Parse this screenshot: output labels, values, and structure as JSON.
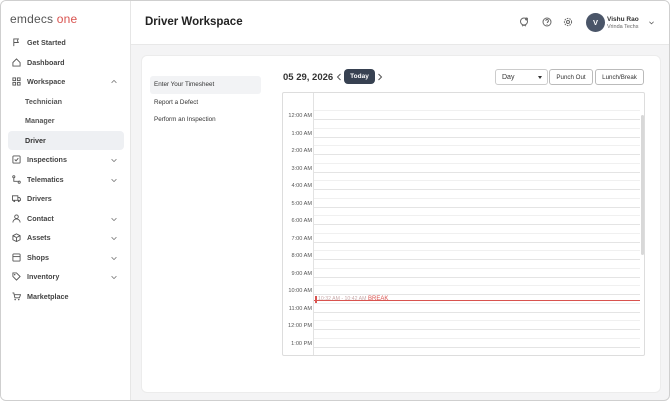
{
  "brand": {
    "logo_text": "emdecs ",
    "logo_accent": "one",
    "accent_color": "#d9534f"
  },
  "sidebar": {
    "items": [
      {
        "label": "Get Started",
        "icon": "flag-icon"
      },
      {
        "label": "Dashboard",
        "icon": "home-icon"
      },
      {
        "label": "Workspace",
        "icon": "grid-icon",
        "expanded": true,
        "children": [
          "Technician",
          "Manager",
          "Driver"
        ],
        "active_child": "Driver"
      },
      {
        "label": "Inspections",
        "icon": "checkbox-icon",
        "has_chevron": true
      },
      {
        "label": "Telematics",
        "icon": "route-icon",
        "has_chevron": true
      },
      {
        "label": "Drivers",
        "icon": "truck-icon"
      },
      {
        "label": "Contact",
        "icon": "person-icon",
        "has_chevron": true
      },
      {
        "label": "Assets",
        "icon": "box-icon",
        "has_chevron": true
      },
      {
        "label": "Shops",
        "icon": "shop-icon",
        "has_chevron": true
      },
      {
        "label": "Inventory",
        "icon": "tag-icon",
        "has_chevron": true
      },
      {
        "label": "Marketplace",
        "icon": "cart-icon"
      }
    ]
  },
  "header": {
    "title": "Driver Workspace",
    "user": {
      "initial": "V",
      "name": "Vishu Rao",
      "org": "Vrinda Techs"
    }
  },
  "main": {
    "menu": [
      "Enter Your Timesheet",
      "Report a Defect",
      "Perform an Inspection"
    ],
    "active_menu": "Enter Your Timesheet",
    "date": "05 29, 2026",
    "today_label": "Today",
    "view_select": "Day",
    "punch_out_label": "Punch Out",
    "lunch_break_label": "Lunch/Break",
    "time_slots": [
      "12:00 AM",
      "1:00 AM",
      "2:00 AM",
      "3:00 AM",
      "4:00 AM",
      "5:00 AM",
      "6:00 AM",
      "7:00 AM",
      "8:00 AM",
      "9:00 AM",
      "10:00 AM",
      "11:00 AM",
      "12:00 PM",
      "1:00 PM"
    ],
    "event": {
      "time_range": "10:32 AM - 10:42 AM",
      "title": "BREAK",
      "color": "#d9534f"
    }
  }
}
